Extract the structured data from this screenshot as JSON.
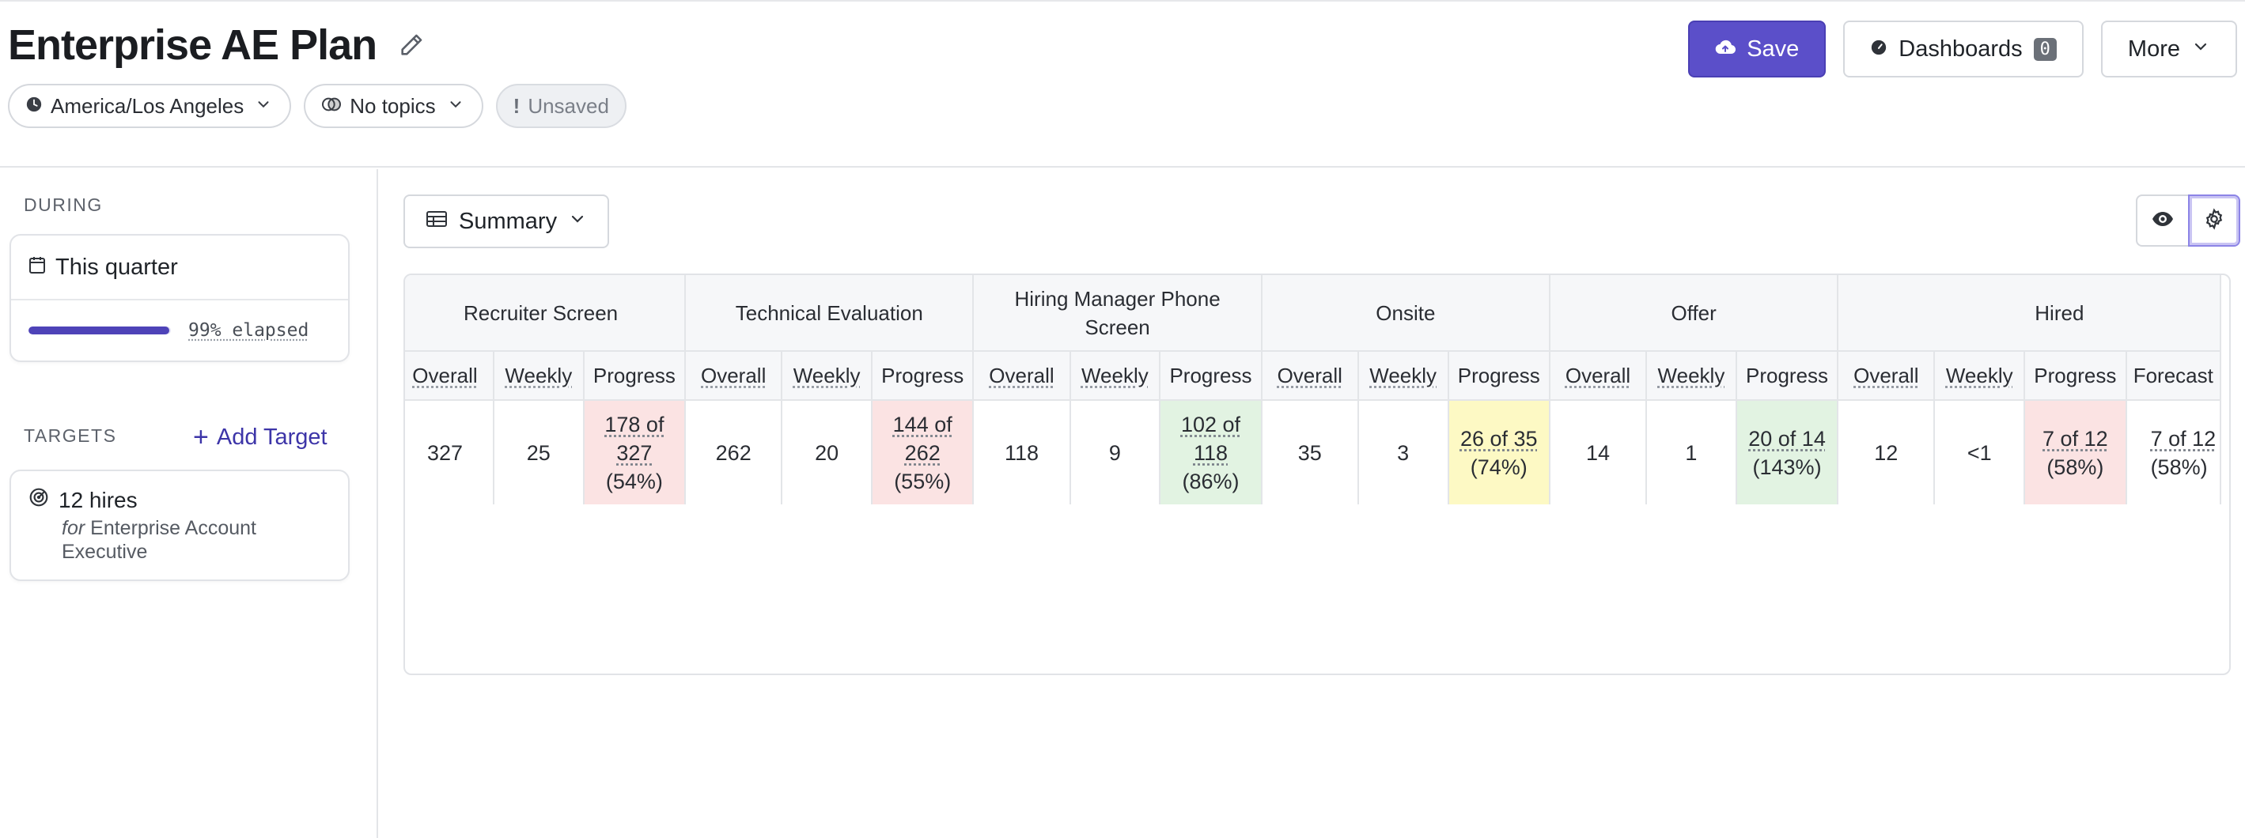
{
  "header": {
    "title": "Enterprise AE Plan",
    "timezone": "America/Los Angeles",
    "topics": "No topics",
    "status": "Unsaved",
    "save_label": "Save",
    "dashboards_label": "Dashboards",
    "dashboards_count": "0",
    "more_label": "More"
  },
  "sidebar": {
    "during_label": "DURING",
    "period": "This quarter",
    "elapsed_text": "99% elapsed",
    "elapsed_fraction": 0.99,
    "targets_label": "TARGETS",
    "add_target_label": "Add Target",
    "target": {
      "title": "12 hires",
      "for_word": "for",
      "role": "Enterprise Account Executive"
    }
  },
  "main": {
    "view_label": "Summary",
    "stages": [
      {
        "name": "Recruiter Screen",
        "overall": "327",
        "weekly": "25",
        "progress_line1": "178 of",
        "progress_line2": "327",
        "progress_pct": "(54%)",
        "status": "red"
      },
      {
        "name": "Technical Evaluation",
        "overall": "262",
        "weekly": "20",
        "progress_line1": "144 of",
        "progress_line2": "262",
        "progress_pct": "(55%)",
        "status": "red"
      },
      {
        "name": "Hiring Manager Phone Screen",
        "overall": "118",
        "weekly": "9",
        "progress_line1": "102 of",
        "progress_line2": "118",
        "progress_pct": "(86%)",
        "status": "green"
      },
      {
        "name": "Onsite",
        "overall": "35",
        "weekly": "3",
        "progress_line1": "26 of 35",
        "progress_line2": "",
        "progress_pct": "(74%)",
        "status": "yellow"
      },
      {
        "name": "Offer",
        "overall": "14",
        "weekly": "1",
        "progress_line1": "20 of 14",
        "progress_line2": "",
        "progress_pct": "(143%)",
        "status": "green"
      },
      {
        "name": "Hired",
        "overall": "12",
        "weekly": "<1",
        "progress_line1": "7 of 12",
        "progress_line2": "",
        "progress_pct": "(58%)",
        "status": "red",
        "forecast_line1": "7 of 12",
        "forecast_pct": "(58%)"
      }
    ],
    "col_overall": "Overall",
    "col_weekly": "Weekly",
    "col_progress": "Progress",
    "col_forecast": "Forecast"
  },
  "colors": {
    "accent": "#5b4fc9",
    "red_cell": "#fbe3e3",
    "green_cell": "#e2f3e2",
    "yellow_cell": "#fdf9c4"
  },
  "icons": [
    "edit-icon",
    "clock-icon",
    "topics-icon",
    "cloud-upload-icon",
    "dashboard-gauge-icon",
    "chevron-down-icon",
    "calendar-icon",
    "target-icon",
    "table-icon",
    "eye-icon",
    "gear-icon",
    "plus-icon"
  ]
}
